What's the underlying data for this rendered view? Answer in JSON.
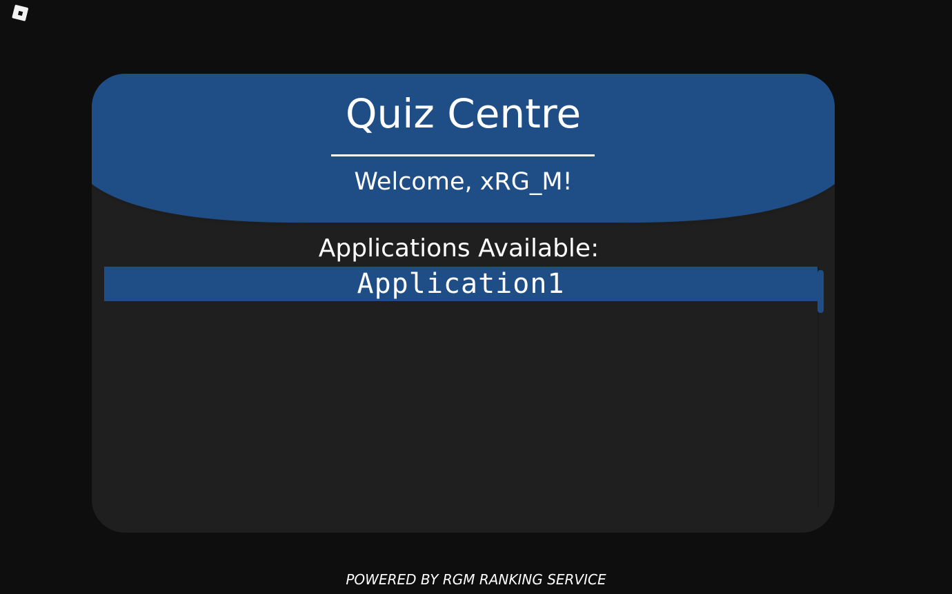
{
  "app": {
    "title": "Quiz Centre",
    "welcome": "Welcome, xRG_M!",
    "brand_color": "#1f4e87",
    "logo_icon": "roblox-logo-icon"
  },
  "applications": {
    "heading": "Applications Available:",
    "items": [
      {
        "label": "Application1"
      }
    ]
  },
  "footer": {
    "text": "POWERED BY RGM RANKING SERVICE"
  }
}
